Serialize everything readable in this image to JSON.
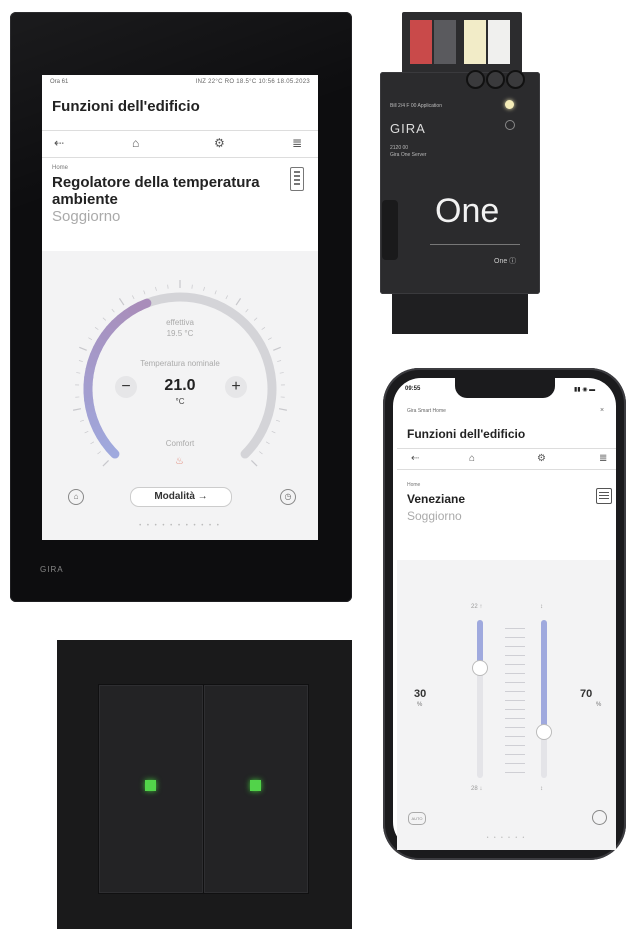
{
  "panel": {
    "status_left": "Ora 61",
    "status_right": "INZ 22°C  RO 18.5°C  10:56  18.05.2023",
    "screen_title": "Funzioni dell'edificio",
    "nav_icons": [
      "arrow-left-icon",
      "home-icon",
      "gear-icon",
      "list-icon"
    ],
    "function_caption": "Home",
    "function_title": "Regolatore della temperatura ambiente",
    "function_room": "Soggiorno",
    "actual_label": "effettiva",
    "actual_value": "19.5 °C",
    "manual_label": "Temperatura nominale",
    "setpoint": "21.0",
    "setpoint_unit": "°C",
    "minus": "−",
    "plus": "+",
    "comfort_label": "Comfort",
    "mode_button": "Modalità →",
    "page_dots": "• • • • • • • • • • •",
    "brand": "GIRA",
    "dial_level": 0.42,
    "colors": {
      "dial_cold": "#9fa9de",
      "dial_warm": "#a98cb8",
      "dial_rest": "#d4d4d8"
    }
  },
  "server": {
    "gira": "GIRA",
    "line1": "2120 00",
    "line2": "Gira One Server",
    "header_small": "Bill 2/4 F 00          Application",
    "one_large": "One",
    "one_small": "One ⓘ",
    "terminal_colors": [
      "#c94a4a",
      "#5a5a5e",
      "#f2ecc8",
      "#f0f0ee"
    ]
  },
  "phone": {
    "time": "09:55",
    "signal": "▮▮ ◉ ▬",
    "app_name": "Gira Smart Home",
    "close": "×",
    "title": "Funzioni dell'edificio",
    "nav_icons": [
      "arrow-left-icon",
      "home-icon",
      "gear-icon",
      "list-icon"
    ],
    "function_caption": "Home",
    "function_title": "Veneziane",
    "function_room": "Soggiorno",
    "left_value": "30",
    "left_unit": "%",
    "right_value": "70",
    "right_unit": "%",
    "left_top": "22 ↑",
    "right_top": "↕",
    "left_bottom": "28 ↓",
    "right_bottom": "↕",
    "auto": "AUTO",
    "page_dots": "• • • • • •",
    "left_position": 0.3,
    "right_position": 0.7
  },
  "switch": {
    "led_color": "#52d34a"
  }
}
